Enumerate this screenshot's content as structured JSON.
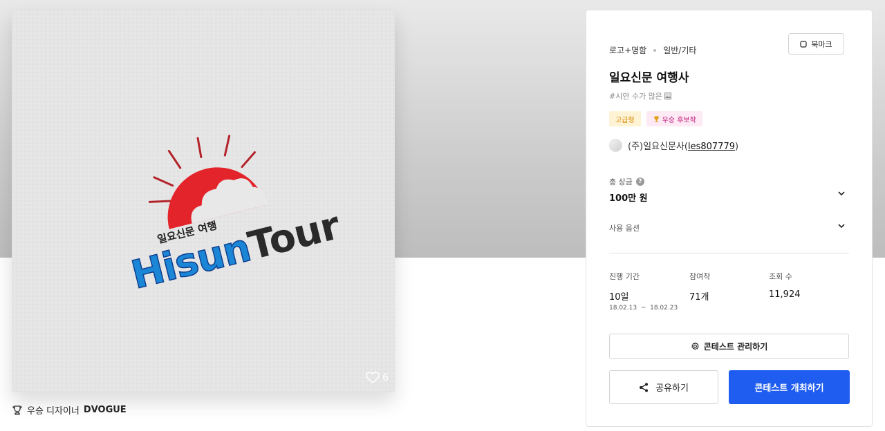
{
  "preview": {
    "logo_small_text": "일요신문 여행",
    "logo_word_blue": "Hisun",
    "logo_word_black": "Tour",
    "likes": "6",
    "heart_icon": "heart-outline-icon"
  },
  "winner": {
    "prefix": "우승 디자이너",
    "designer": "DVOGUE",
    "icon": "trophy-icon"
  },
  "contest": {
    "category": "로고+명함",
    "subcategory": "일반/기타",
    "bookmark_label": "북마크",
    "title": "일요신문 여행사",
    "tagline": "#시안 수가 많은",
    "badges": {
      "premium": "고급형",
      "candidate": "우승 후보작"
    },
    "holder_company": "(주)일요신문사",
    "holder_id": "les807779",
    "prize_label": "총 상금",
    "prize_value": "100만 원",
    "usage_label": "사용 옵션",
    "stats": {
      "duration_label": "진행 기간",
      "duration_value": "10일",
      "duration_start": "18.02.13",
      "duration_end": "18.02.23",
      "entries_label": "참여작",
      "entries_value": "71개",
      "views_label": "조회 수",
      "views_value": "11,924"
    },
    "manage_button": "콘테스트 관리하기",
    "share_button": "공유하기",
    "host_button": "콘테스트 개최하기"
  },
  "colors": {
    "primary_button": "#1f5cf0",
    "logo_red": "#e3242b",
    "logo_blue": "#1c86d6",
    "premium_badge": "#d78a00",
    "candidate_badge": "#c0167a"
  }
}
